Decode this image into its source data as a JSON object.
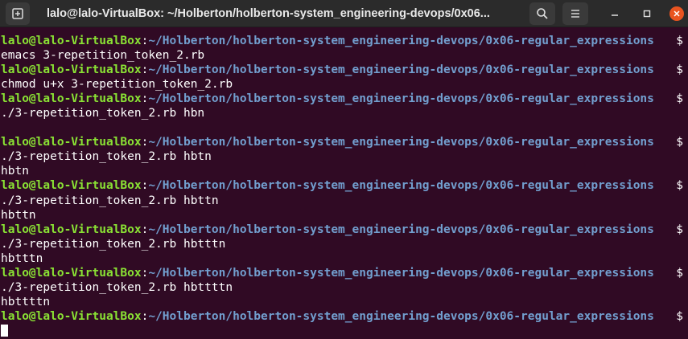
{
  "window": {
    "title": "lalo@lalo-VirtualBox: ~/Holberton/holberton-system_engineering-devops/0x06...",
    "icons": {
      "new_tab": "new-tab-icon",
      "search": "search-icon",
      "menu": "hamburger-menu-icon",
      "minimize": "minimize-icon",
      "maximize": "maximize-icon",
      "close": "close-icon"
    },
    "accent_close": "#e95420"
  },
  "terminal": {
    "colors": {
      "background": "#300a24",
      "user": "#8ae234",
      "path": "#729fcf",
      "text": "#ffffff"
    },
    "prompt": {
      "user": "lalo@lalo-VirtualBox",
      "colon": ":",
      "path": "~/Holberton/holberton-system_engineering-devops/0x06-regular_expressions",
      "dollar": "$"
    },
    "lines": [
      {
        "type": "prompt"
      },
      {
        "type": "text",
        "text": "emacs 3-repetition_token_2.rb"
      },
      {
        "type": "prompt"
      },
      {
        "type": "text",
        "text": "chmod u+x 3-repetition_token_2.rb"
      },
      {
        "type": "prompt"
      },
      {
        "type": "text",
        "text": "./3-repetition_token_2.rb hbn"
      },
      {
        "type": "text",
        "text": ""
      },
      {
        "type": "prompt"
      },
      {
        "type": "text",
        "text": "./3-repetition_token_2.rb hbtn"
      },
      {
        "type": "text",
        "text": "hbtn"
      },
      {
        "type": "prompt"
      },
      {
        "type": "text",
        "text": "./3-repetition_token_2.rb hbttn"
      },
      {
        "type": "text",
        "text": "hbttn"
      },
      {
        "type": "prompt"
      },
      {
        "type": "text",
        "text": "./3-repetition_token_2.rb hbtttn"
      },
      {
        "type": "text",
        "text": "hbtttn"
      },
      {
        "type": "prompt"
      },
      {
        "type": "text",
        "text": "./3-repetition_token_2.rb hbttttn"
      },
      {
        "type": "text",
        "text": "hbttttn"
      },
      {
        "type": "prompt"
      },
      {
        "type": "cursor"
      }
    ]
  }
}
